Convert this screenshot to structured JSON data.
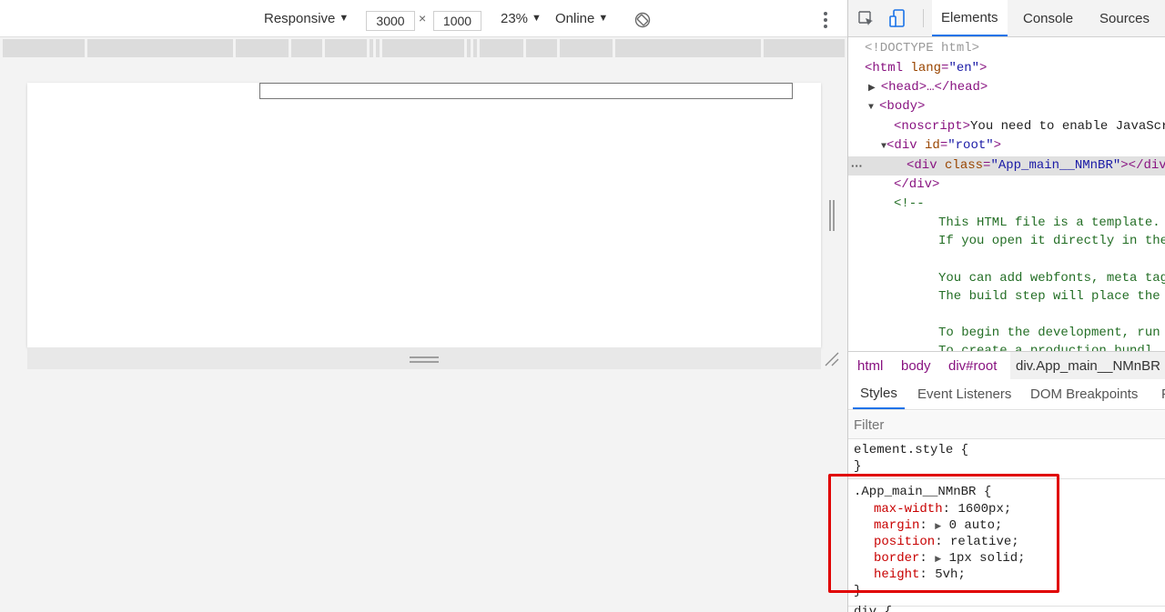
{
  "device_toolbar": {
    "device_label": "Responsive",
    "width_value": "3000",
    "times_symbol": "×",
    "height_value": "1000",
    "zoom_label": "23%",
    "network_label": "Online"
  },
  "devtools": {
    "tabs": [
      "Elements",
      "Console",
      "Sources"
    ],
    "active_tab": "Elements",
    "dom": {
      "doctype": "<!DOCTYPE html>",
      "html_open": "<html",
      "html_lang_attr": " lang",
      "html_lang_val": "\"en\"",
      "head_text": "<head>…</head>",
      "body_text": "<body>",
      "noscript_open": "<noscript>",
      "noscript_text": "You need to enable JavaScr",
      "div_root_open": "<div",
      "div_root_attr": " id",
      "div_root_val": "\"root\"",
      "div_app_open": "<div",
      "div_app_attr": " class",
      "div_app_val": "\"App_main__NMnBR\"",
      "div_app_close": "></div",
      "div_close": "</div>",
      "comment_open": "<!--",
      "comment_lines": [
        "This HTML file is a template.",
        "If you open it directly in the",
        "You can add webfonts, meta tag",
        "The build step will place the",
        "To begin the development, run",
        "To create a production bundl"
      ]
    },
    "breadcrumb": [
      "html",
      "body",
      "div#root",
      "div.App_main__NMnBR"
    ],
    "styles_tabs": [
      "Styles",
      "Event Listeners",
      "DOM Breakpoints",
      "P"
    ],
    "filter_placeholder": "Filter",
    "element_style": {
      "selector": "element.style {",
      "close": "}"
    },
    "app_main_rule": {
      "selector": ".App_main__NMnBR {",
      "properties": [
        {
          "name": "max-width",
          "value": "1600px;"
        },
        {
          "name": "margin",
          "value": "0 auto;"
        },
        {
          "name": "position",
          "value": "relative;"
        },
        {
          "name": "border",
          "value": "1px solid;"
        },
        {
          "name": "height",
          "value": "5vh;"
        }
      ],
      "close": "}"
    },
    "next_rule_selector": "div {"
  },
  "colors": {
    "highlight": "#e00000",
    "active_tab_underline": "#1a73e8"
  }
}
